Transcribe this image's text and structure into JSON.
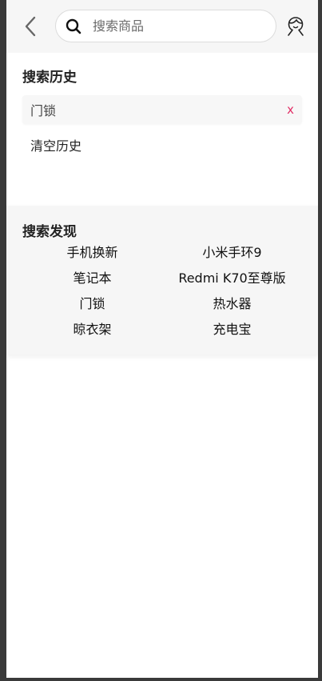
{
  "header": {
    "back_icon": "chevron-left-icon",
    "search_icon": "search-icon",
    "search_placeholder": "搜索商品",
    "search_value": "",
    "user_icon": "user-icon"
  },
  "history": {
    "title": "搜索历史",
    "items": [
      {
        "label": "门锁",
        "delete_label": "x"
      }
    ],
    "clear_label": "清空历史"
  },
  "discover": {
    "title": "搜索发现",
    "items": [
      "手机换新",
      "小米手环9",
      "笔记本",
      "Redmi K70至尊版",
      "门锁",
      "热水器",
      "晾衣架",
      "充电宝"
    ]
  },
  "colors": {
    "delete_accent": "#e0245e",
    "header_bg": "#f6f6f6",
    "discover_bg": "#f6f6f6"
  }
}
